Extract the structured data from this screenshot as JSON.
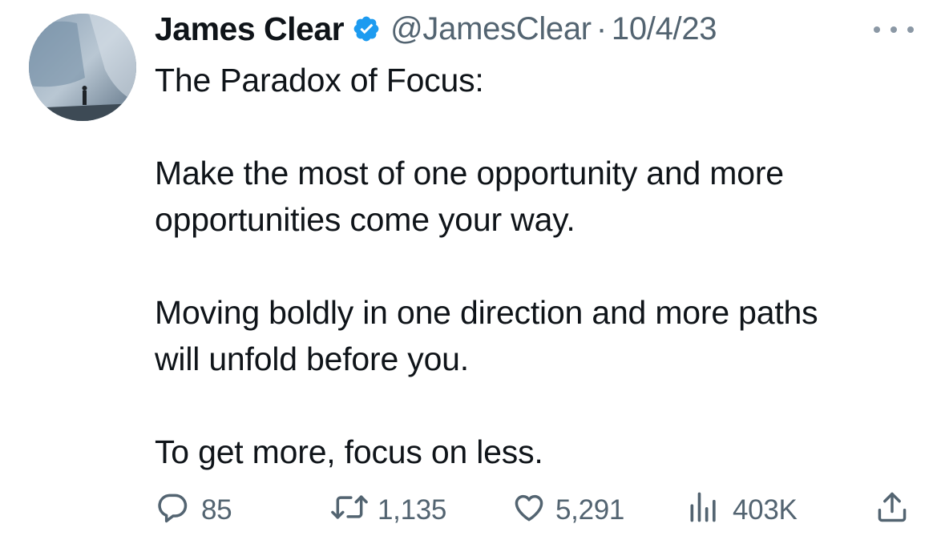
{
  "author": {
    "name": "James Clear",
    "handle": "@JamesClear",
    "separator": "·",
    "date": "10/4/23"
  },
  "tweet": {
    "lines": [
      "The Paradox of Focus:",
      "Make the most of one opportunity and more",
      "opportunities come your way.",
      "Moving boldly in one direction and more paths",
      "will unfold before you.",
      "To get more, focus on less."
    ]
  },
  "actions": {
    "replies": "85",
    "reposts": "1,135",
    "likes": "5,291",
    "views": "403K"
  },
  "icons": {
    "verified": "verified-badge-icon",
    "more": "more-options-icon",
    "reply": "reply-icon",
    "repost": "repost-icon",
    "like": "heart-icon",
    "views": "views-chart-icon",
    "share": "share-icon"
  },
  "colors": {
    "text": "#0f1419",
    "secondary": "#536471",
    "verified": "#1d9bf0",
    "background": "#ffffff"
  }
}
